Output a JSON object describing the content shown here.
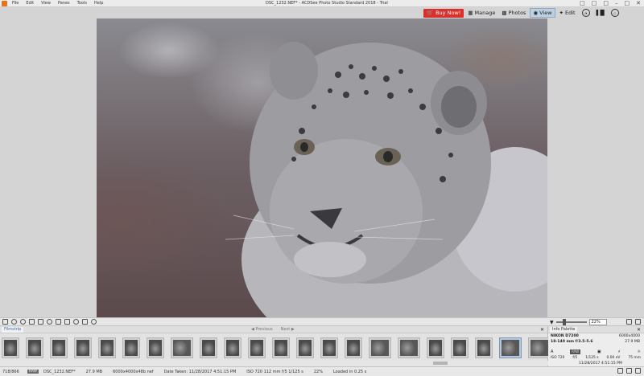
{
  "titlebar": {
    "window_title": "DSC_1232.NEF* - ACDSee Photo Studio Standard 2018 - Trial",
    "menu": [
      "File",
      "Edit",
      "View",
      "Panes",
      "Tools",
      "Help"
    ]
  },
  "modebar": {
    "buy_now": "Buy Now!",
    "manage": "Manage",
    "photos": "Photos",
    "view": "View",
    "edit": "Edit",
    "active_mode": "View"
  },
  "viewer": {
    "zoom": "22%"
  },
  "filmstrip": {
    "tab_label": "Filmstrip",
    "previous": "Previous",
    "next": "Next",
    "thumbnails": [
      {
        "kind": "portrait"
      },
      {
        "kind": "portrait"
      },
      {
        "kind": "portrait"
      },
      {
        "kind": "portrait"
      },
      {
        "kind": "portrait"
      },
      {
        "kind": "portrait"
      },
      {
        "kind": "portrait"
      },
      {
        "kind": "landscape"
      },
      {
        "kind": "portrait"
      },
      {
        "kind": "portrait"
      },
      {
        "kind": "portrait"
      },
      {
        "kind": "portrait"
      },
      {
        "kind": "portrait"
      },
      {
        "kind": "portrait"
      },
      {
        "kind": "portrait"
      },
      {
        "kind": "landscape"
      },
      {
        "kind": "landscape"
      },
      {
        "kind": "portrait"
      },
      {
        "kind": "portrait"
      },
      {
        "kind": "portrait"
      },
      {
        "kind": "landscape"
      },
      {
        "kind": "landscape"
      },
      {
        "kind": "portrait"
      }
    ],
    "selected_index": 20
  },
  "info_palette": {
    "tab_label": "Info Palette",
    "camera": "NIKON D7200",
    "lens": "18-140 mm f/3.5-5.6",
    "dimensions": "6000x4000",
    "file_size": "27.9 MB",
    "mode": "A",
    "badge": "RAW",
    "iso": "ISO 720",
    "aperture": "f/5",
    "shutter": "1/125 s",
    "exposure": "0.00 eV",
    "focal_length": "75 mm",
    "date": "11/28/2017 4:51:15 PM"
  },
  "statusbar": {
    "position": "718/866",
    "raw_badge": "RAW",
    "filename": "DSC_1232.NEF*",
    "size": "27.9 MB",
    "dims": "6000x4000x48b nef",
    "date_taken": "Date Taken: 11/28/2017 4:51:15 PM",
    "exif": "ISO 720  112 mm  f/5  1/125 s",
    "zoom": "22%",
    "loaded": "Loaded in 0.25 s"
  }
}
